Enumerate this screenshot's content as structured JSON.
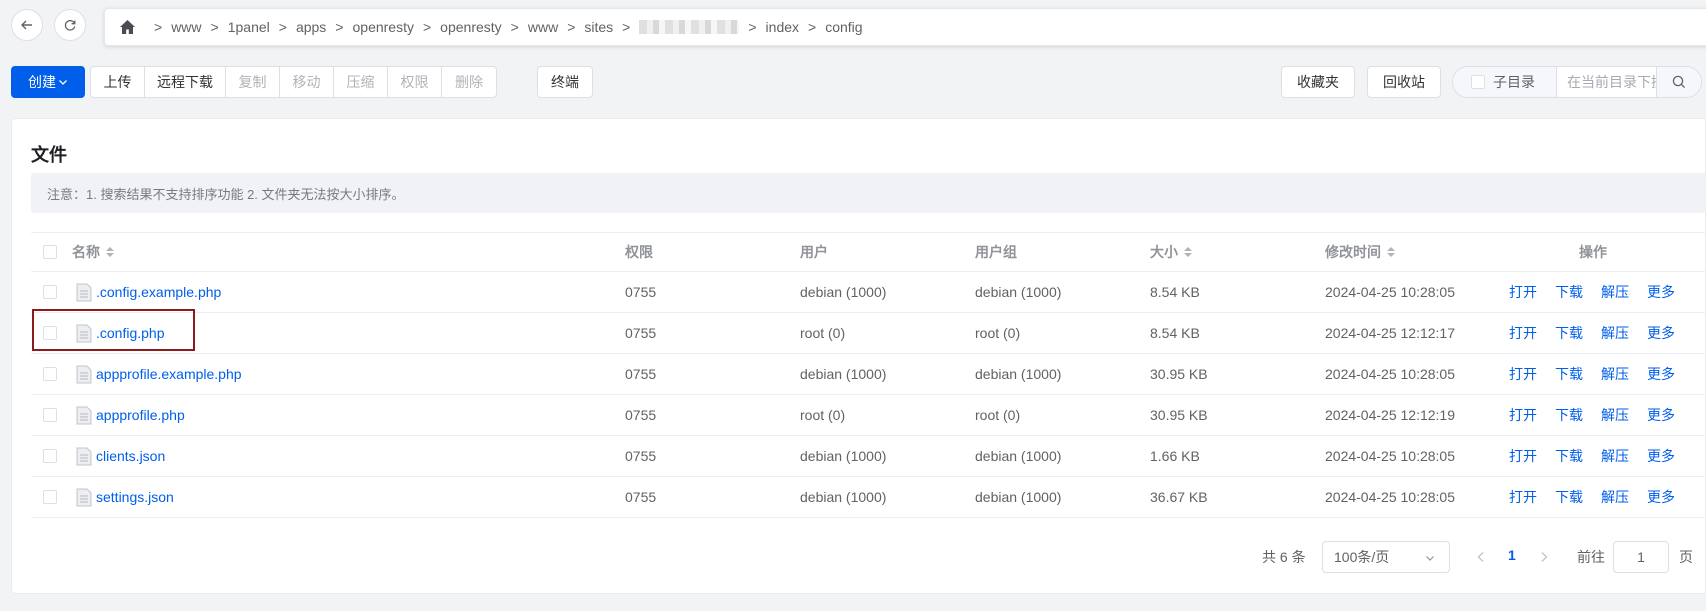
{
  "nav": {
    "back_icon": "arrow-left-icon",
    "refresh_icon": "refresh-icon",
    "home_icon": "home-icon",
    "breadcrumbs": [
      "www",
      "1panel",
      "apps",
      "openresty",
      "openresty",
      "www",
      "sites",
      "index",
      "config"
    ],
    "separator": ">"
  },
  "toolbar": {
    "create_label": "创建",
    "upload_label": "上传",
    "remote_download_label": "远程下载",
    "copy_label": "复制",
    "move_label": "移动",
    "compress_label": "压缩",
    "permission_label": "权限",
    "delete_label": "删除",
    "terminal_label": "终端",
    "favorites_label": "收藏夹",
    "recycle_label": "回收站",
    "subdir_label": "子目录",
    "search_placeholder": "在当前目录下搜索文件"
  },
  "card": {
    "title": "文件",
    "notice": "注意：1. 搜索结果不支持排序功能 2. 文件夹无法按大小排序。"
  },
  "table": {
    "headers": {
      "name": "名称",
      "permission": "权限",
      "user": "用户",
      "group": "用户组",
      "size": "大小",
      "modified": "修改时间",
      "actions": "操作"
    },
    "actions": [
      "打开",
      "下载",
      "解压",
      "更多"
    ],
    "rows": [
      {
        "name": ".config.example.php",
        "permission": "0755",
        "user": "debian (1000)",
        "group": "debian (1000)",
        "size": "8.54 KB",
        "modified": "2024-04-25 10:28:05"
      },
      {
        "name": ".config.php",
        "permission": "0755",
        "user": "root (0)",
        "group": "root (0)",
        "size": "8.54 KB",
        "modified": "2024-04-25 12:12:17"
      },
      {
        "name": "appprofile.example.php",
        "permission": "0755",
        "user": "debian (1000)",
        "group": "debian (1000)",
        "size": "30.95 KB",
        "modified": "2024-04-25 10:28:05"
      },
      {
        "name": "appprofile.php",
        "permission": "0755",
        "user": "root (0)",
        "group": "root (0)",
        "size": "30.95 KB",
        "modified": "2024-04-25 12:12:19"
      },
      {
        "name": "clients.json",
        "permission": "0755",
        "user": "debian (1000)",
        "group": "debian (1000)",
        "size": "1.66 KB",
        "modified": "2024-04-25 10:28:05"
      },
      {
        "name": "settings.json",
        "permission": "0755",
        "user": "debian (1000)",
        "group": "debian (1000)",
        "size": "36.67 KB",
        "modified": "2024-04-25 10:28:05"
      }
    ]
  },
  "pagination": {
    "total": "共 6 条",
    "page_size": "100条/页",
    "current_page": "1",
    "goto_label": "前往",
    "goto_value": "1",
    "page_suffix": "页"
  },
  "colors": {
    "primary": "#005eeb",
    "highlight": "#8b1c1c"
  }
}
